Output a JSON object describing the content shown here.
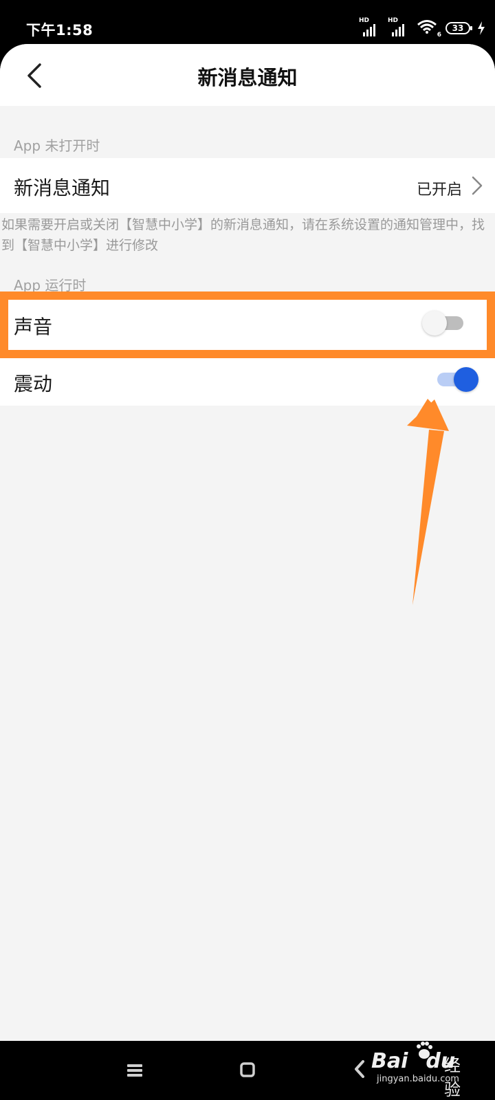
{
  "status_bar": {
    "time": "下午1:58",
    "battery": "33",
    "signal1_label": "HD",
    "signal2_label": "HD",
    "wifi_label": "6"
  },
  "header": {
    "title": "新消息通知"
  },
  "section_closed": {
    "label": "App 未打开时",
    "row": {
      "label": "新消息通知",
      "value": "已开启"
    },
    "hint": "如果需要开启或关闭【智慧中小学】的新消息通知，请在系统设置的通知管理中，找到【智慧中小学】进行修改"
  },
  "section_running": {
    "label": "App 运行时",
    "rows": [
      {
        "label": "声音",
        "state": "off"
      },
      {
        "label": "震动",
        "state": "on"
      }
    ]
  },
  "colors": {
    "accent": "#1f5fe0",
    "highlight": "#ff8a2a"
  },
  "watermark": {
    "brand": "Bai",
    "brand2": "du",
    "suffix": "经验",
    "url": "jingyan.baidu.com"
  }
}
